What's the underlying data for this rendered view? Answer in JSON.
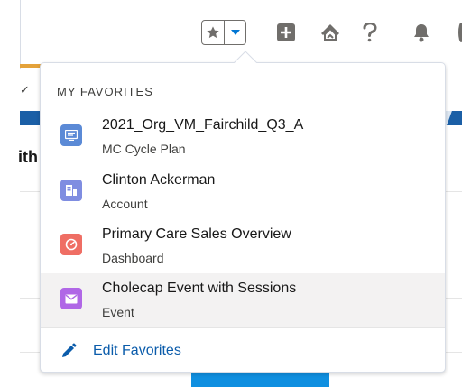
{
  "header": {
    "icons": [
      "star-icon",
      "chevron-down-icon",
      "plus-icon",
      "trailhead-icon",
      "help-icon",
      "bell-icon"
    ],
    "colors": {
      "icon_gray": "#706e6b",
      "drop_blue": "#0176d3"
    }
  },
  "background": {
    "tab_check": "✓",
    "heading_partial": "ith",
    "colors": {
      "orange_tab": "#e4a23a",
      "blue_band": "#1b5fa6",
      "button": "#0f8fe0"
    }
  },
  "favorites": {
    "title": "MY FAVORITES",
    "items": [
      {
        "name": "2021_Org_VM_Fairchild_Q3_A",
        "type": "MC Cycle Plan",
        "icon": "document-icon",
        "color": "#5b8ad6"
      },
      {
        "name": "Clinton Ackerman",
        "type": "Account",
        "icon": "building-icon",
        "color": "#7f8de1"
      },
      {
        "name": "Primary Care Sales Overview",
        "type": "Dashboard",
        "icon": "gauge-icon",
        "color": "#ef6e64"
      },
      {
        "name": "Cholecap Event with Sessions",
        "type": "Event",
        "icon": "envelope-icon",
        "color": "#b067e6"
      }
    ],
    "edit_label": "Edit Favorites",
    "edit_icon": "pencil-icon",
    "colors": {
      "link": "#0b5cab",
      "active_row": "#f3f2f2"
    }
  }
}
